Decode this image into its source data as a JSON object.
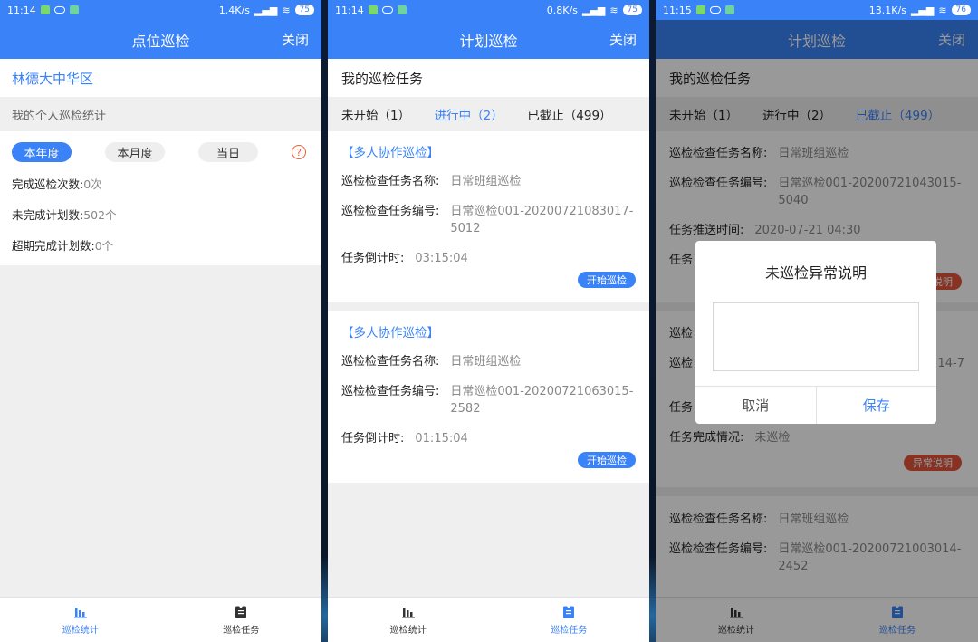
{
  "colors": {
    "primary": "#3a82f7",
    "danger": "#e2543b",
    "background": "#efefef"
  },
  "panel1": {
    "status": {
      "time": "11:14",
      "speed": "1.4K/s",
      "battery": "75"
    },
    "title": "点位巡检",
    "close": "关闭",
    "site_name": "林德大中华区",
    "section_label": "我的个人巡检统计",
    "ranges": [
      {
        "label": "本年度",
        "active": true
      },
      {
        "label": "本月度",
        "active": false
      },
      {
        "label": "当日",
        "active": false
      }
    ],
    "help_glyph": "?",
    "stats": [
      {
        "label": "完成巡检次数:",
        "value": "0次"
      },
      {
        "label": "未完成计划数:",
        "value": "502个"
      },
      {
        "label": "超期完成计划数:",
        "value": "0个"
      }
    ]
  },
  "panel2": {
    "status": {
      "time": "11:14",
      "speed": "0.8K/s",
      "battery": "75"
    },
    "title": "计划巡检",
    "close": "关闭",
    "heading": "我的巡检任务",
    "filters": [
      "未开始（1）",
      "进行中（2）",
      "已截止（499）"
    ],
    "active_filter": 1,
    "tasks": [
      {
        "tag": "【多人协作巡检】",
        "name_label": "巡检检查任务名称:",
        "name": "日常班组巡检",
        "code_label": "巡检检查任务编号:",
        "code": "日常巡检001-20200721083017-5012",
        "countdown_label": "任务倒计时:",
        "countdown": "03:15:04",
        "button": "开始巡检"
      },
      {
        "tag": "【多人协作巡检】",
        "name_label": "巡检检查任务名称:",
        "name": "日常班组巡检",
        "code_label": "巡检检查任务编号:",
        "code": "日常巡检001-20200721063015-2582",
        "countdown_label": "任务倒计时:",
        "countdown": "01:15:04",
        "button": "开始巡检"
      }
    ]
  },
  "panel3": {
    "status": {
      "time": "11:15",
      "speed": "13.1K/s",
      "battery": "76"
    },
    "title": "计划巡检",
    "close": "关闭",
    "heading": "我的巡检任务",
    "filters": [
      "未开始（1）",
      "进行中（2）",
      "已截止（499）"
    ],
    "active_filter": 2,
    "task1": {
      "name_label": "巡检检查任务名称:",
      "name": "日常班组巡检",
      "code_label": "巡检检查任务编号:",
      "code": "日常巡检001-20200721043015-5040",
      "push_label": "任务推送时间:",
      "push": "2020-07-21 04:30",
      "partial_label": "任务",
      "exception_partial": "说明"
    },
    "task2": {
      "partial1": "巡检",
      "partial2": "巡检",
      "partial2_tail": "14-7",
      "partial3": "任务",
      "status_label": "任务完成情况:",
      "status": "未巡检",
      "exception_button": "异常说明"
    },
    "task3": {
      "name_label": "巡检检查任务名称:",
      "name": "日常班组巡检",
      "code_label": "巡检检查任务编号:",
      "code": "日常巡检001-20200721003014-2452"
    },
    "dialog": {
      "title": "未巡检异常说明",
      "textarea_value": "",
      "cancel": "取消",
      "save": "保存"
    }
  },
  "tabbar": [
    {
      "label": "巡检统计",
      "icon": "bar-chart-icon"
    },
    {
      "label": "巡检任务",
      "icon": "clipboard-icon"
    }
  ]
}
